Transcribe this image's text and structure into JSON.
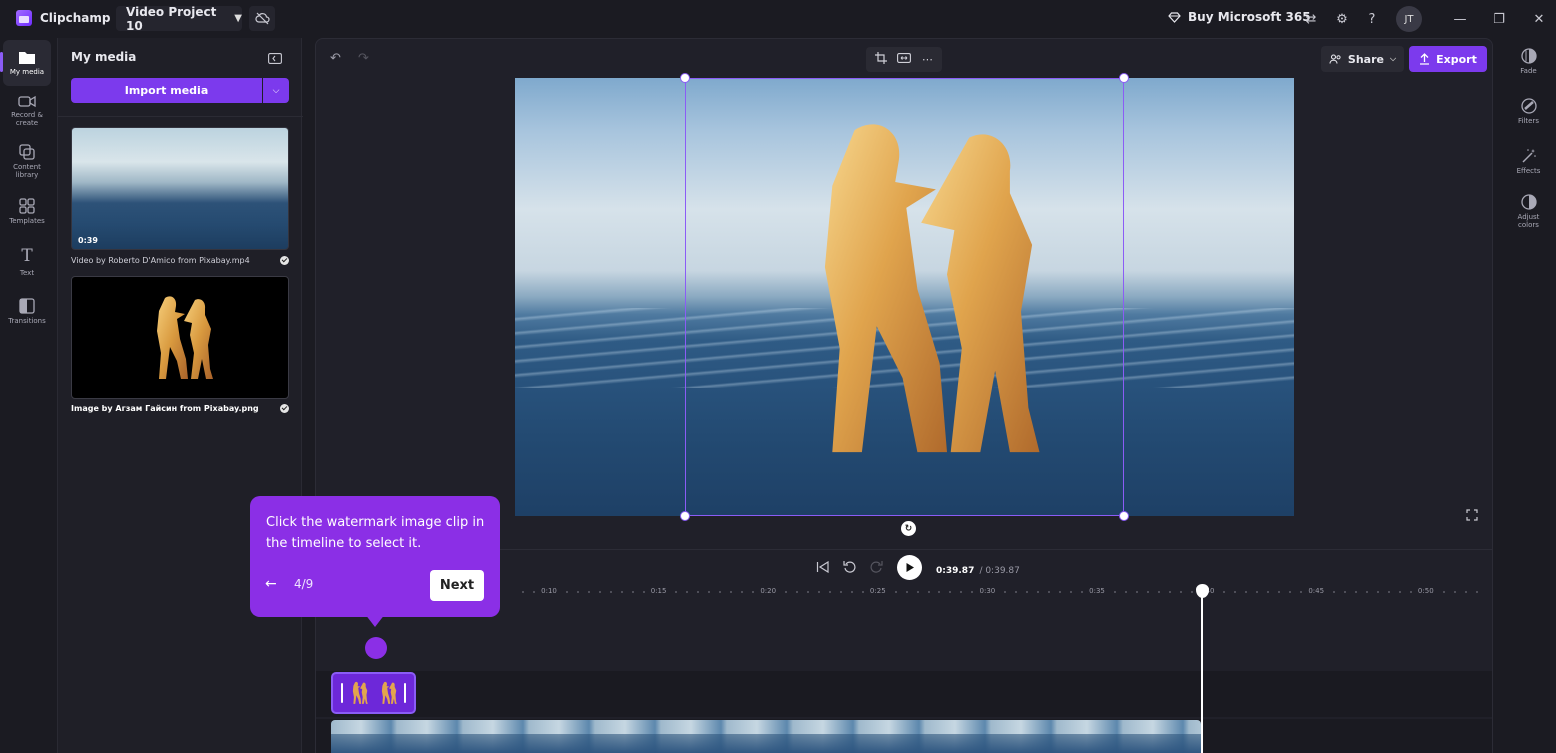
{
  "app": {
    "name": "Clipchamp",
    "project_name": "Video Project 10",
    "buy_label": "Buy Microsoft 365",
    "user_initials": "JT"
  },
  "leftnav": {
    "items": [
      {
        "label": "My media",
        "icon": "folder-icon",
        "active": true
      },
      {
        "label": "Record & create",
        "icon": "camera-icon"
      },
      {
        "label": "Content library",
        "icon": "library-icon"
      },
      {
        "label": "Templates",
        "icon": "templates-icon"
      },
      {
        "label": "Text",
        "icon": "text-icon"
      },
      {
        "label": "Transitions",
        "icon": "transitions-icon"
      }
    ]
  },
  "media_panel": {
    "title": "My media",
    "import_label": "Import media",
    "items": [
      {
        "duration": "0:39",
        "caption": "Video by Roberto D'Amico from Pixabay.mp4"
      },
      {
        "caption": "Image by Агзам Гайсин from Pixabay.png"
      }
    ]
  },
  "editor": {
    "share_label": "Share",
    "export_label": "Export",
    "time_current": "0:39.87",
    "time_total": "/ 0:39.87",
    "ruler_ticks": [
      "0:10",
      "0:15",
      "0:20",
      "0:25",
      "0:30",
      "0:35",
      "0:40",
      "0:45",
      "0:50"
    ]
  },
  "tooltip": {
    "text": "Click the watermark image clip in the timeline to select it.",
    "step": "4/9",
    "next_label": "Next"
  },
  "rightnav": {
    "items": [
      {
        "label": "Fade",
        "icon": "fade-icon"
      },
      {
        "label": "Filters",
        "icon": "filters-icon"
      },
      {
        "label": "Effects",
        "icon": "effects-icon"
      },
      {
        "label": "Adjust colors",
        "icon": "adjust-colors-icon"
      }
    ]
  },
  "colors": {
    "accent": "#7c3aed",
    "tooltip": "#8b2fe6",
    "background": "#1b1b22"
  }
}
